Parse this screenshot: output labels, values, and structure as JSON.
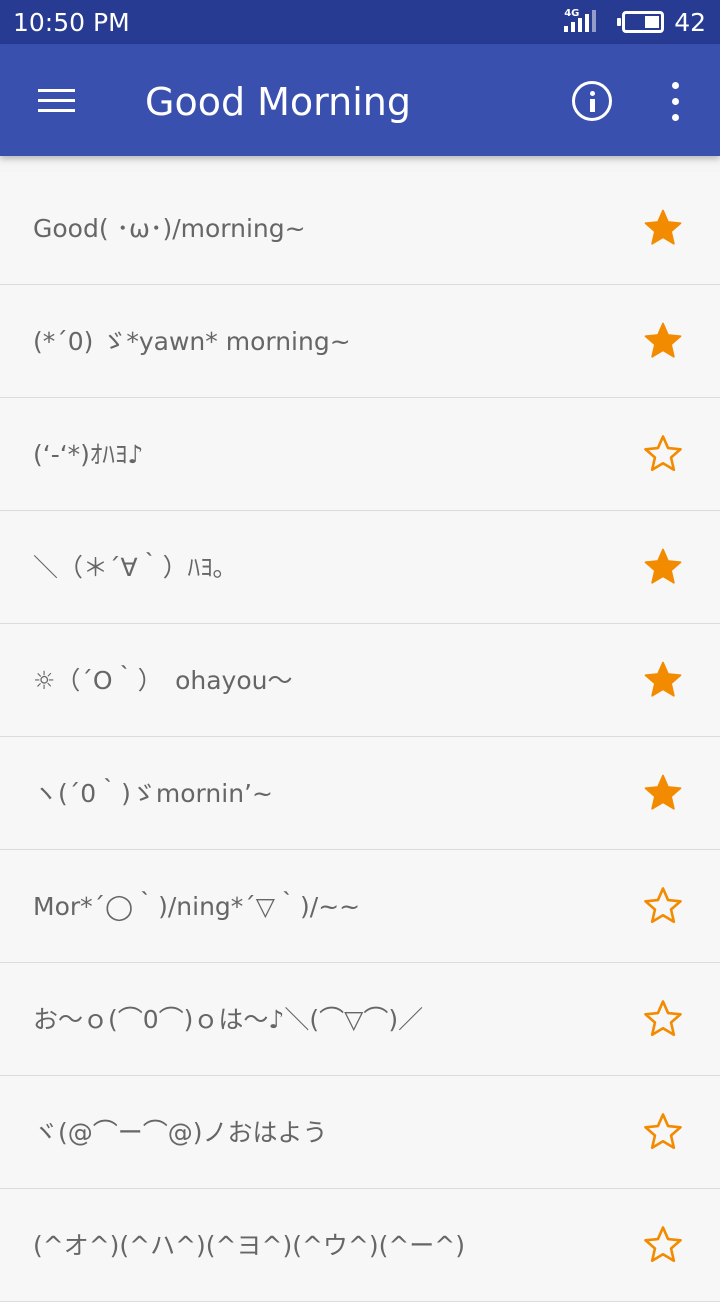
{
  "status_bar": {
    "time": "10:50 PM",
    "network": "4G",
    "battery_level": "42",
    "battery_fill": 0.42
  },
  "app_bar": {
    "title": "Good Morning",
    "menu_icon": "hamburger-menu-icon",
    "info_icon": "info-icon",
    "more_icon": "more-vert-icon"
  },
  "accent_color": "#f38b00",
  "toolbar_color": "#3a50ae",
  "status_color": "#283b93",
  "items": [
    {
      "text": "Good( ･ω･)/morning~",
      "favorite": true
    },
    {
      "text": "(*´0) ゞ*yawn* morning~",
      "favorite": true
    },
    {
      "text": "(‘-‘*)ｵﾊﾖ♪",
      "favorite": false
    },
    {
      "text": "＼（＊´∀｀）ﾊﾖ｡",
      "favorite": true
    },
    {
      "text": "☼（´O｀）　ohayou〜",
      "favorite": true
    },
    {
      "text": "ヽ(´0｀)ゞmornin’~",
      "favorite": true
    },
    {
      "text": "Mor*´◯｀)/ning*´▽｀)/~~",
      "favorite": false
    },
    {
      "text": "お〜ｏ(⌒0⌒)ｏは〜♪＼(⌒▽⌒)／",
      "favorite": false
    },
    {
      "text": "ヾ(@⌒ー⌒@)ノおはよう",
      "favorite": false
    },
    {
      "text": "(^オ^)(^ハ^)(^ヨ^)(^ウ^)(^ー^)",
      "favorite": false
    }
  ]
}
